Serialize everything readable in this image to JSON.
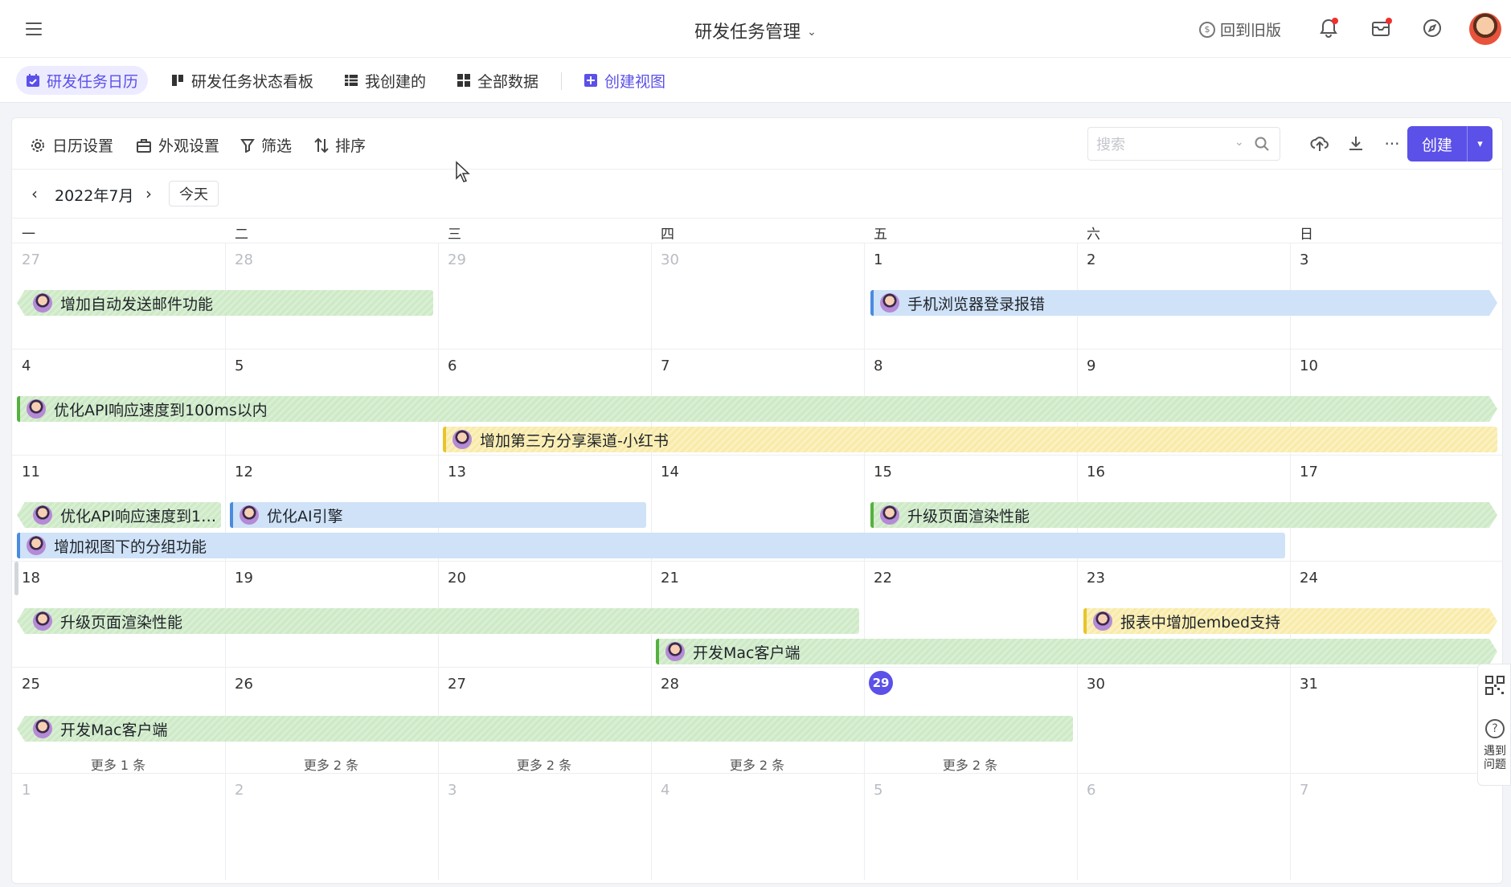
{
  "header": {
    "title": "研发任务管理",
    "old_version": "回到旧版"
  },
  "tabs": [
    {
      "label": "研发任务日历",
      "active": true
    },
    {
      "label": "研发任务状态看板",
      "active": false
    },
    {
      "label": "我创建的",
      "active": false
    },
    {
      "label": "全部数据",
      "active": false
    }
  ],
  "create_view": "创建视图",
  "toolbar": {
    "calendar_settings": "日历设置",
    "appearance_settings": "外观设置",
    "filter": "筛选",
    "sort": "排序",
    "search_placeholder": "搜索",
    "create": "创建"
  },
  "calendar": {
    "month_label": "2022年7月",
    "today": "今天",
    "weekdays": [
      "一",
      "二",
      "三",
      "四",
      "五",
      "六",
      "日"
    ],
    "weeks": [
      [
        "27",
        "28",
        "29",
        "30",
        "1",
        "2",
        "3"
      ],
      [
        "4",
        "5",
        "6",
        "7",
        "8",
        "9",
        "10"
      ],
      [
        "11",
        "12",
        "13",
        "14",
        "15",
        "16",
        "17"
      ],
      [
        "18",
        "19",
        "20",
        "21",
        "22",
        "23",
        "24"
      ],
      [
        "25",
        "26",
        "27",
        "28",
        "29",
        "30",
        "31"
      ],
      [
        "1",
        "2",
        "3",
        "4",
        "5",
        "6",
        "7"
      ]
    ],
    "today_date": "29",
    "events": [
      {
        "title": "增加自动发送邮件功能",
        "color": "green"
      },
      {
        "title": "手机浏览器登录报错",
        "color": "blue"
      },
      {
        "title": "优化API响应速度到100ms以内",
        "color": "green"
      },
      {
        "title": "增加第三方分享渠道-小红书",
        "color": "yellow"
      },
      {
        "title": "优化API响应速度到10...",
        "color": "green"
      },
      {
        "title": "优化AI引擎",
        "color": "blue"
      },
      {
        "title": "升级页面渲染性能",
        "color": "green"
      },
      {
        "title": "增加视图下的分组功能",
        "color": "blue"
      },
      {
        "title": "升级页面渲染性能",
        "color": "green"
      },
      {
        "title": "报表中增加embed支持",
        "color": "yellow"
      },
      {
        "title": "开发Mac客户端",
        "color": "green"
      },
      {
        "title": "开发Mac客户端",
        "color": "green"
      }
    ],
    "more": [
      "更多 1 条",
      "更多 2 条",
      "更多 2 条",
      "更多 2 条",
      "更多 2 条"
    ]
  },
  "side_widget": {
    "help": "遇到问题"
  },
  "colors": {
    "accent": "#5b50e8",
    "green": "#cde9c6",
    "blue": "#cfe2f7",
    "yellow": "#f8eaa8"
  }
}
